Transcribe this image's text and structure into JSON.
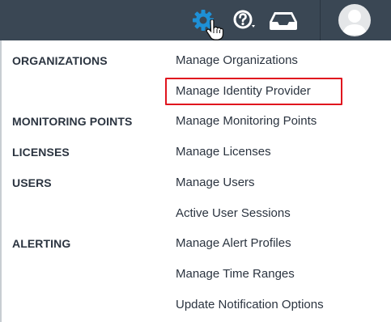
{
  "topbar": {
    "icons": {
      "settings": "gear-icon",
      "help": "help-icon",
      "inbox": "inbox-icon",
      "avatar": "user-avatar"
    },
    "colors": {
      "background": "#3a4754",
      "settings_icon": "#1e90d6",
      "icon": "#ffffff"
    }
  },
  "menu": {
    "categories": {
      "organizations": "ORGANIZATIONS",
      "monitoring_points": "MONITORING POINTS",
      "licenses": "LICENSES",
      "users": "USERS",
      "alerting": "ALERTING"
    },
    "items": {
      "manage_organizations": "Manage Organizations",
      "manage_identity_provider": "Manage Identity Provider",
      "manage_monitoring_points": "Manage Monitoring Points",
      "manage_licenses": "Manage Licenses",
      "manage_users": "Manage Users",
      "active_user_sessions": "Active User Sessions",
      "manage_alert_profiles": "Manage Alert Profiles",
      "manage_time_ranges": "Manage Time Ranges",
      "update_notification_options": "Update Notification Options"
    },
    "highlight_color": "#e0141e"
  }
}
